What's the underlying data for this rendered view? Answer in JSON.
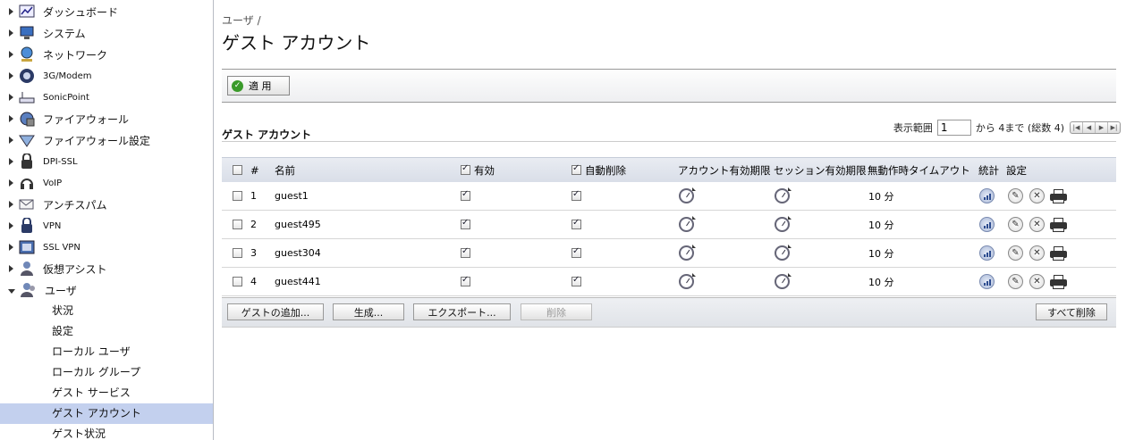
{
  "sidebar": {
    "items": [
      {
        "label": "ダッシュボード",
        "icon": "dashboard-icon"
      },
      {
        "label": "システム",
        "icon": "monitor-icon"
      },
      {
        "label": "ネットワーク",
        "icon": "globe-icon"
      },
      {
        "label": "3G/Modem",
        "icon": "modem-icon"
      },
      {
        "label": "SonicPoint",
        "icon": "access-point-icon"
      },
      {
        "label": "ファイアウォール",
        "icon": "firewall-icon"
      },
      {
        "label": "ファイアウォール設定",
        "icon": "firewall-settings-icon"
      },
      {
        "label": "DPI-SSL",
        "icon": "dpi-ssl-icon"
      },
      {
        "label": "VoIP",
        "icon": "headset-icon"
      },
      {
        "label": "アンチスパム",
        "icon": "mail-icon"
      },
      {
        "label": "VPN",
        "icon": "vpn-lock-icon"
      },
      {
        "label": "SSL VPN",
        "icon": "ssl-vpn-icon"
      },
      {
        "label": "仮想アシスト",
        "icon": "assist-icon"
      },
      {
        "label": "ユーザ",
        "icon": "users-icon"
      }
    ],
    "user_subitems": [
      "状況",
      "設定",
      "ローカル ユーザ",
      "ローカル グループ",
      "ゲスト サービス",
      "ゲスト アカウント",
      "ゲスト状況"
    ],
    "active_subitem": "ゲスト アカウント"
  },
  "breadcrumb": "ユーザ /",
  "page_title": "ゲスト アカウント",
  "toolbar": {
    "apply_label": "適 用"
  },
  "section_title": "ゲスト アカウント",
  "pager": {
    "prefix": "表示範囲",
    "value": "1",
    "suffix": "から 4まで (総数 4)"
  },
  "table": {
    "headers": {
      "num": "#",
      "name": "名前",
      "enabled": "有効",
      "auto_delete": "自動削除",
      "account_expiry": "アカウント有効期限",
      "session_expiry": "セッション有効期限",
      "idle_timeout": "無動作時タイムアウト",
      "stats": "統計",
      "settings": "設定"
    },
    "rows": [
      {
        "num": "1",
        "name": "guest1",
        "timeout": "10 分"
      },
      {
        "num": "2",
        "name": "guest495",
        "timeout": "10 分"
      },
      {
        "num": "3",
        "name": "guest304",
        "timeout": "10 分"
      },
      {
        "num": "4",
        "name": "guest441",
        "timeout": "10 分"
      }
    ]
  },
  "buttons": {
    "add_guest": "ゲストの追加...",
    "generate": "生成...",
    "export": "エクスポート...",
    "delete": "削除",
    "delete_all": "すべて削除"
  }
}
